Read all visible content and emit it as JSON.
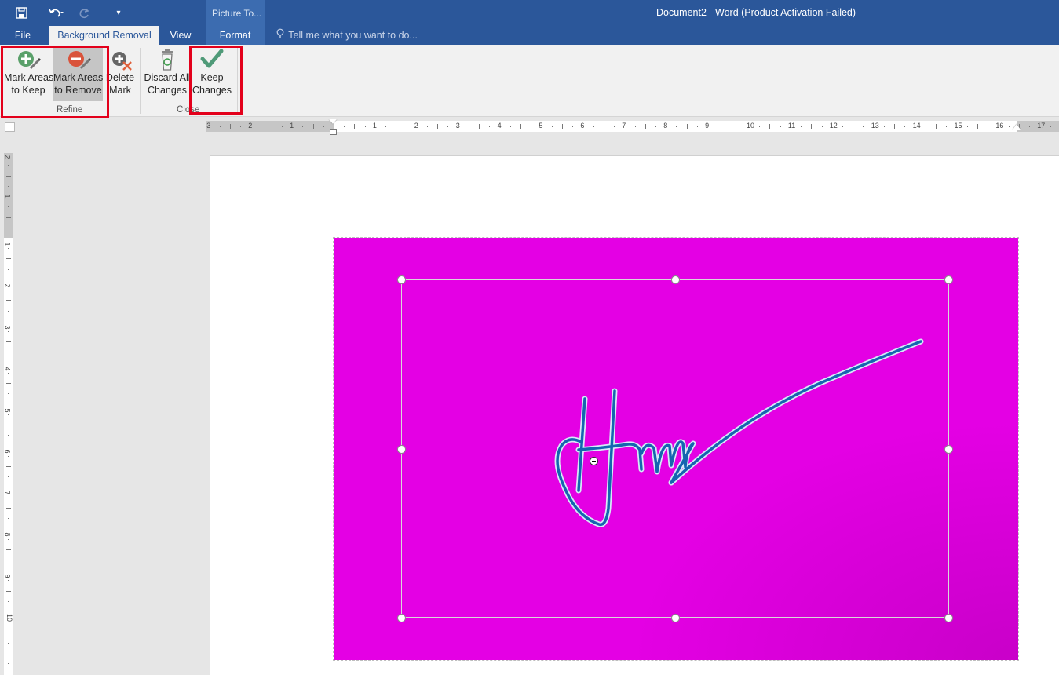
{
  "window": {
    "title": "Document2 - Word (Product Activation Failed)",
    "contextual_group": "Picture To..."
  },
  "quick_access": {
    "save_icon": "save-icon",
    "undo_icon": "undo-icon",
    "redo_icon": "redo-icon",
    "customize_icon": "customize-qat-icon"
  },
  "tabs": [
    {
      "label": "File"
    },
    {
      "label": "Background Removal"
    },
    {
      "label": "View"
    },
    {
      "label": "Format"
    }
  ],
  "tell_me": {
    "placeholder": "Tell me what you want to do..."
  },
  "ribbon": {
    "mark_keep": {
      "line1": "Mark Areas",
      "line2": "to Keep"
    },
    "mark_remove": {
      "line1": "Mark Areas",
      "line2": "to Remove"
    },
    "delete_mark": {
      "line1": "Delete",
      "line2": "Mark"
    },
    "discard": {
      "line1": "Discard All",
      "line2": "Changes"
    },
    "keep_changes": {
      "line1": "Keep",
      "line2": "Changes"
    },
    "groups": {
      "refine": "Refine",
      "close": "Close"
    }
  },
  "ruler": {
    "horizontal_labels": [
      "3",
      "2",
      "1",
      "1",
      "2",
      "3",
      "4",
      "5",
      "6",
      "7",
      "8",
      "9",
      "10",
      "11",
      "12",
      "13",
      "14",
      "15",
      "16",
      "17"
    ],
    "vertical_labels": [
      "2",
      "1",
      "1",
      "2",
      "3",
      "4",
      "5",
      "6",
      "7",
      "8",
      "9",
      "10"
    ]
  },
  "colors": {
    "title_bar": "#2b579a",
    "image_background": "#e400e4",
    "signature_ink": "#1565b0",
    "highlight_box": "#e3001b"
  }
}
